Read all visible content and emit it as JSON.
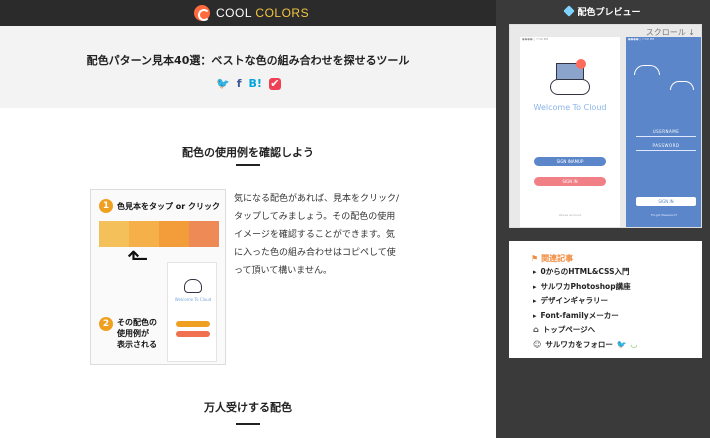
{
  "header": {
    "logo_word1": "COOL",
    "logo_word2": "COLORS",
    "brand_colors": {
      "primary": "#ff6b3d",
      "accent_yellow": "#f5c542",
      "accent_blue": "#7fd3ff"
    }
  },
  "hero": {
    "title": "配色パターン見本40選：ベストな色の組み合わせを探せるツール",
    "share": {
      "twitter": "🐦",
      "facebook": "f",
      "hatena": "B!",
      "pocket": "✔"
    }
  },
  "section1": {
    "title": "配色の使用例を確認しよう",
    "demo": {
      "step1_num": "1",
      "step1_label": "色見本をタップ or クリック",
      "step2_num": "2",
      "step2_label_1": "その配色の",
      "step2_label_2": "使用例が",
      "step2_label_3": "表示される",
      "mini_title": "Welcome To Cloud",
      "palette": [
        "#f3c05a",
        "#f6b04a",
        "#f39c3a",
        "#ee8a55"
      ]
    },
    "description": "気になる配色があれば、見本をクリック/タップしてみましょう。その配色の使用イメージを確認することができます。気に入った色の組み合わせはコピペして使って頂いて構いません。"
  },
  "section2": {
    "title": "万人受けする配色"
  },
  "sidebar": {
    "preview_title": "配色プレビュー",
    "scroll_label": "スクロール ↓",
    "phone1": {
      "status": "●●●●○  7:50 PM",
      "title": "Welcome To Cloud",
      "btn1": "SIGN INAMUP",
      "btn2": "SIGN IN",
      "footer": "Above account"
    },
    "phone2": {
      "status": "●●●●○  7:50 PM",
      "field1": "USERNAME",
      "field2": "PASSWORD",
      "btn": "SIGN IN",
      "footer": "Forgot Password?"
    },
    "related": {
      "title": "関連記事",
      "items": [
        "0からのHTML&CSS入門",
        "サルワカPhotoshop講座",
        "デザインギャラリー",
        "Font-familyメーカー"
      ],
      "top_link": "トップページへ",
      "follow": "サルワカをフォロー"
    }
  }
}
